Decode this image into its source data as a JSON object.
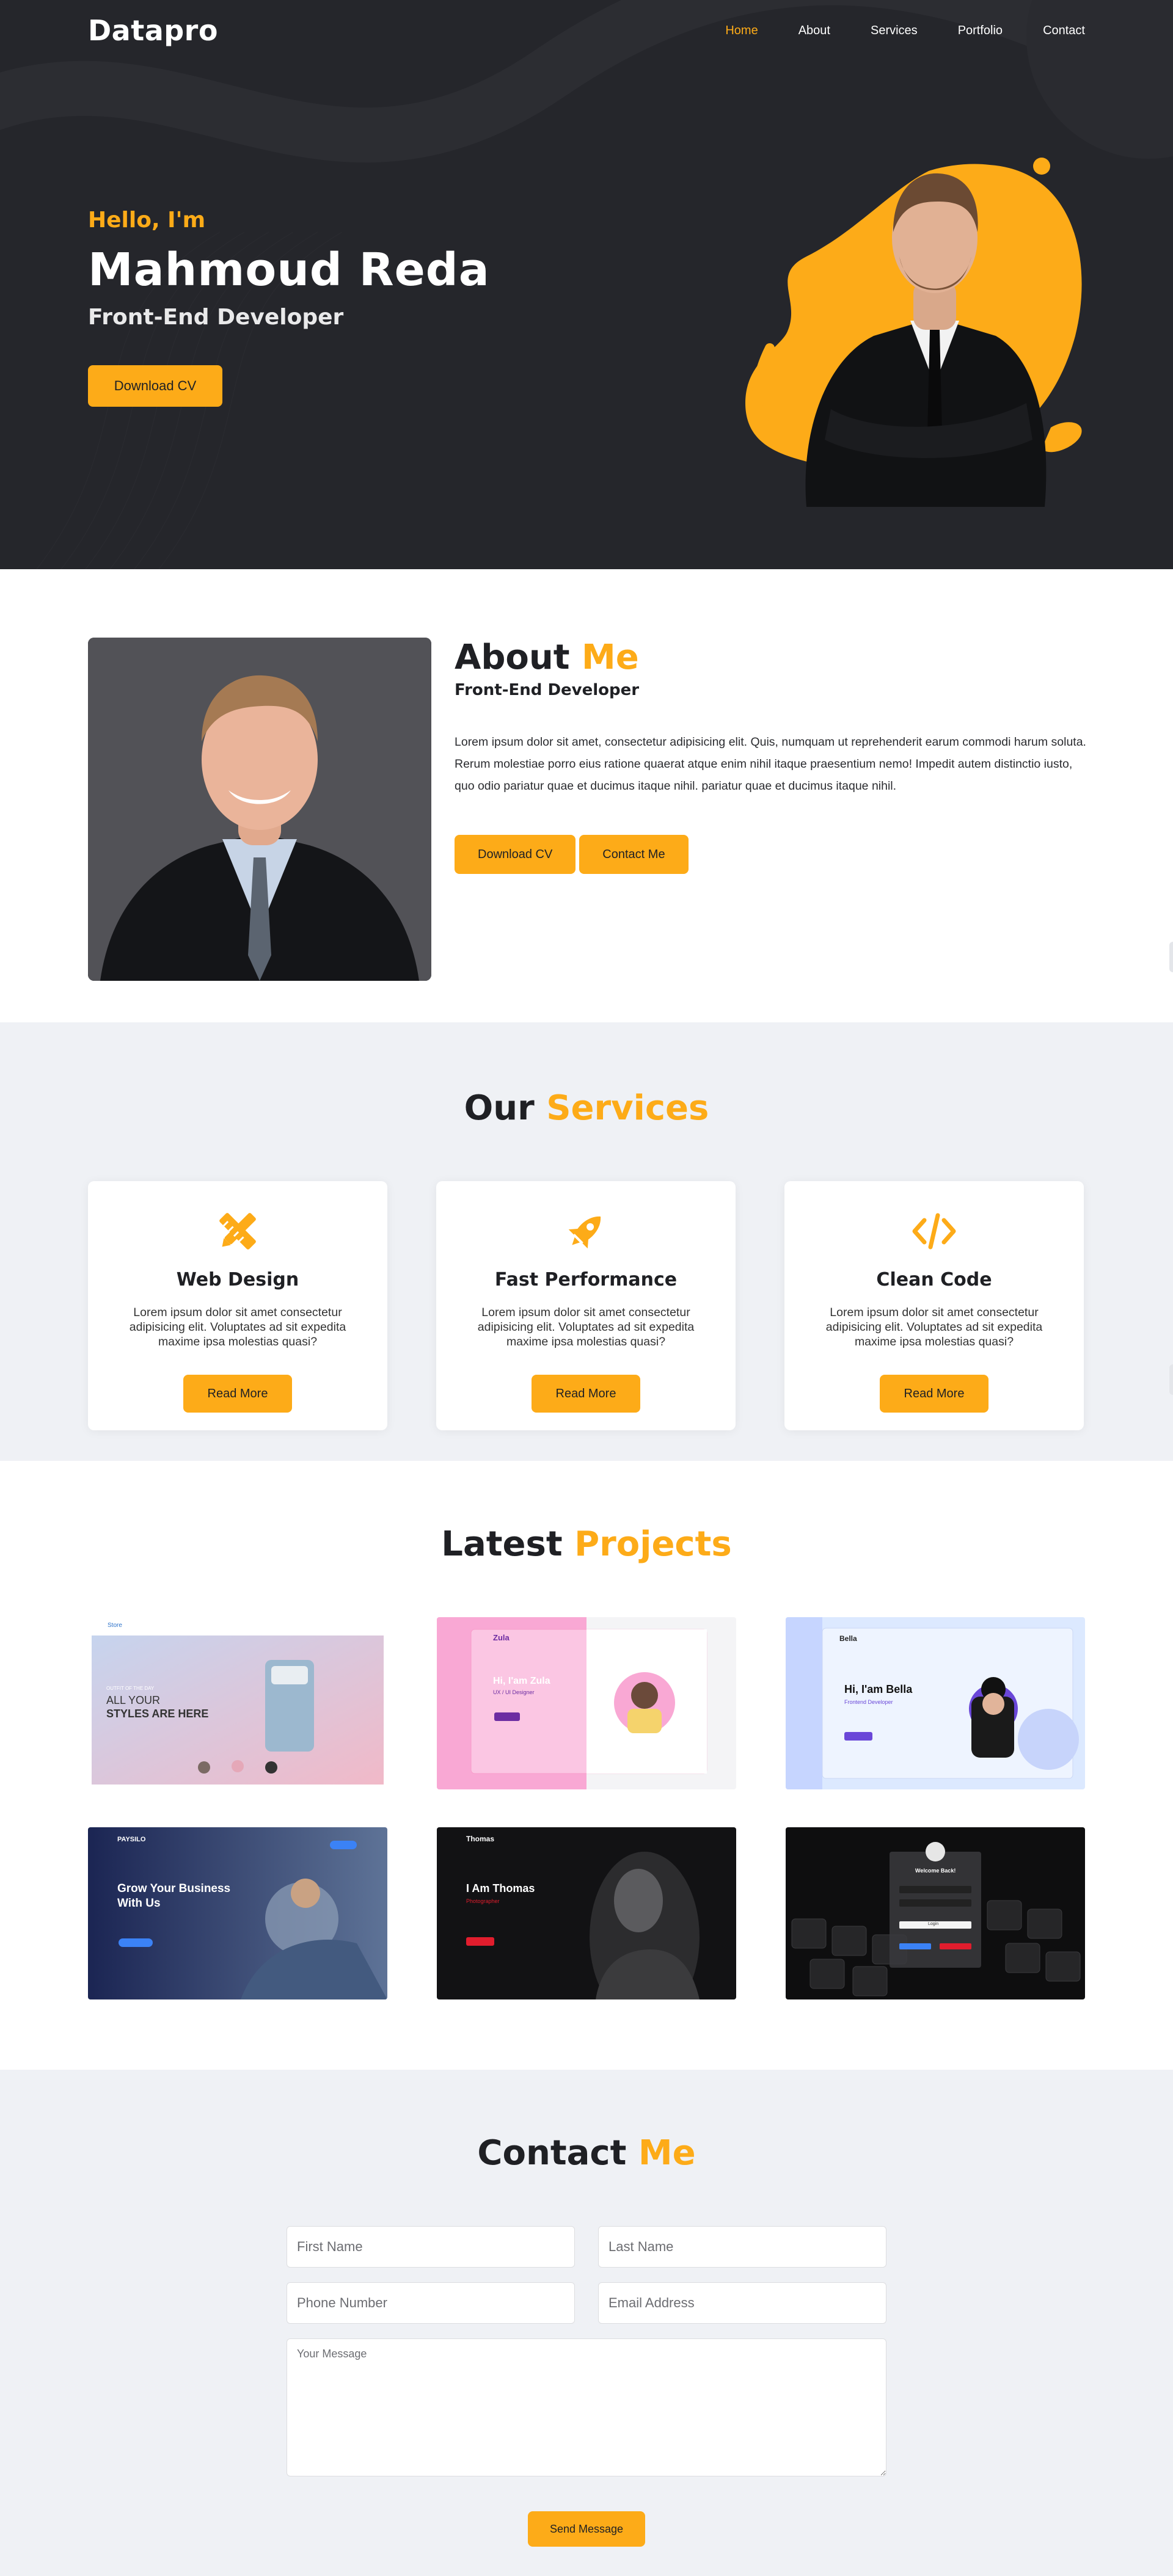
{
  "navbar": {
    "logo": "Datapro",
    "links": [
      "Home",
      "About",
      "Services",
      "Portfolio",
      "Contact"
    ],
    "active": "Home"
  },
  "hero": {
    "hello": "Hello, I'm",
    "name": "Mahmoud Reda",
    "role": "Front-End Developer",
    "button": "Download CV"
  },
  "about": {
    "title_a": "About",
    "title_b": "Me",
    "subtitle": "Front-End Developer",
    "text": "Lorem ipsum dolor sit amet, consectetur adipisicing elit. Quis, numquam ut reprehenderit earum commodi harum soluta. Rerum molestiae porro eius ratione quaerat atque enim nihil itaque praesentium nemo! Impedit autem distinctio iusto, quo odio pariatur quae et ducimus itaque nihil. pariatur quae et ducimus itaque nihil.",
    "button_cv": "Download CV",
    "button_contact": "Contact Me"
  },
  "services": {
    "title_a": "Our",
    "title_b": "Services",
    "cards": [
      {
        "title": "Web Design",
        "text": "Lorem ipsum dolor sit amet consectetur adipisicing elit. Voluptates ad sit expedita maxime ipsa molestias quasi?",
        "button": "Read More",
        "icon": "pencil-ruler-icon"
      },
      {
        "title": "Fast Performance",
        "text": "Lorem ipsum dolor sit amet consectetur adipisicing elit. Voluptates ad sit expedita maxime ipsa molestias quasi?",
        "button": "Read More",
        "icon": "rocket-icon"
      },
      {
        "title": "Clean Code",
        "text": "Lorem ipsum dolor sit amet consectetur adipisicing elit. Voluptates ad sit expedita maxime ipsa molestias quasi?",
        "button": "Read More",
        "icon": "code-icon"
      }
    ]
  },
  "projects": {
    "title_a": "Latest",
    "title_b": "Projects",
    "items": [
      {
        "label": "Store",
        "headline_a": "ALL YOUR",
        "headline_b": "STYLES ARE HERE",
        "kicker": "OUTFIT OF THE DAY"
      },
      {
        "label": "Zula",
        "headline": "Hi, I'am Zula",
        "sub": "UX / UI Designer"
      },
      {
        "label": "Bella",
        "headline": "Hi, I'am Bella",
        "sub": "Frontend Developer"
      },
      {
        "label": "PAYSILO",
        "headline_a": "Grow Your Business",
        "headline_b": "With Us"
      },
      {
        "label": "Thomas",
        "headline": "I Am Thomas",
        "sub": "Photographer"
      },
      {
        "label": "Welcome Back!",
        "sub": "Login"
      }
    ]
  },
  "contact": {
    "title_a": "Contact",
    "title_b": "Me",
    "first_name": "First Name",
    "last_name": "Last Name",
    "phone": "Phone Number",
    "email": "Email Address",
    "message": "Your Message",
    "button": "Send Message"
  },
  "colors": {
    "accent": "#fdab18",
    "dark": "#25262b",
    "light_bg": "#eff1f5"
  }
}
